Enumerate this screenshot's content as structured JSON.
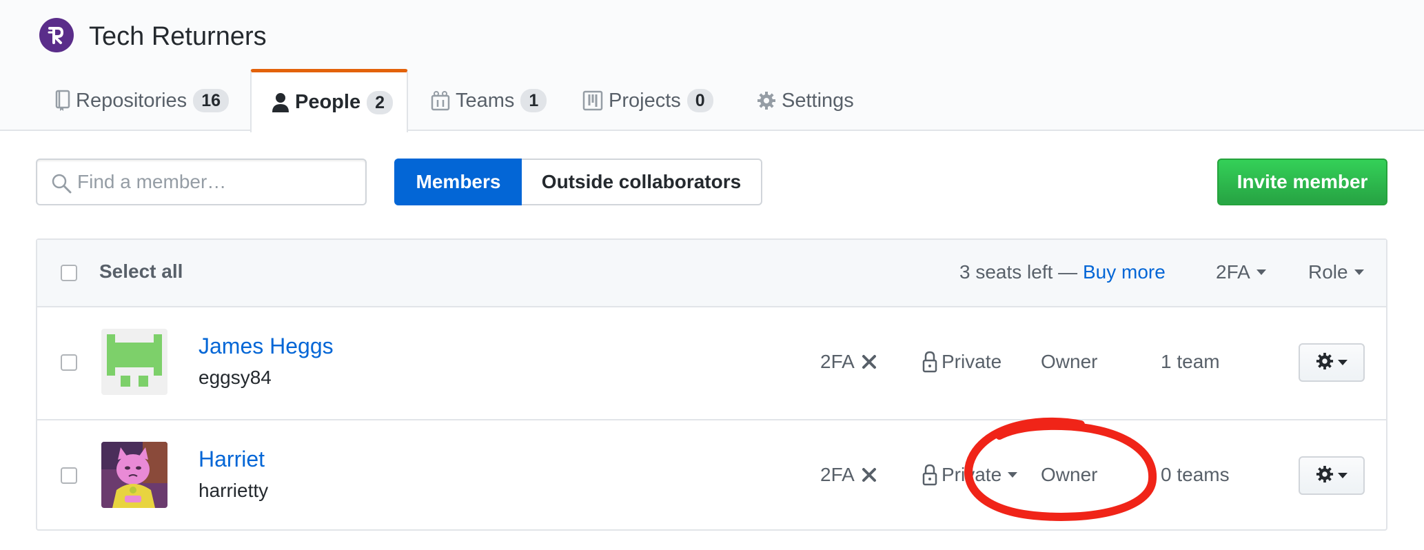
{
  "org": {
    "name": "Tech Returners",
    "logo_color": "#5a2d8a",
    "logo_icon": "tr-monogram-icon"
  },
  "tabs": [
    {
      "label": "Repositories",
      "count": "16",
      "icon": "repo-icon"
    },
    {
      "label": "People",
      "count": "2",
      "icon": "person-icon",
      "selected": true
    },
    {
      "label": "Teams",
      "count": "1",
      "icon": "teams-icon"
    },
    {
      "label": "Projects",
      "count": "0",
      "icon": "project-icon"
    },
    {
      "label": "Settings",
      "icon": "gear-icon"
    }
  ],
  "toolbar": {
    "search_placeholder": "Find a member…",
    "members_label": "Members",
    "outside_label": "Outside collaborators",
    "invite_label": "Invite member"
  },
  "table": {
    "select_all": "Select all",
    "seats_text": "3 seats left —",
    "buy_more": "Buy more",
    "twofa_filter": "2FA",
    "role_filter": "Role"
  },
  "members": [
    {
      "name": "James Heggs",
      "login": "eggsy84",
      "twofa": "2FA",
      "visibility": "Private",
      "role": "Owner",
      "teams": "1 team"
    },
    {
      "name": "Harriet",
      "login": "harrietty",
      "twofa": "2FA",
      "visibility": "Private",
      "role": "Owner",
      "teams": "0 teams"
    }
  ],
  "colors": {
    "link": "#0366d6",
    "primary": "#0366d6",
    "success": "#28a745",
    "tab_accent": "#e36209",
    "annotation": "#f02418"
  }
}
